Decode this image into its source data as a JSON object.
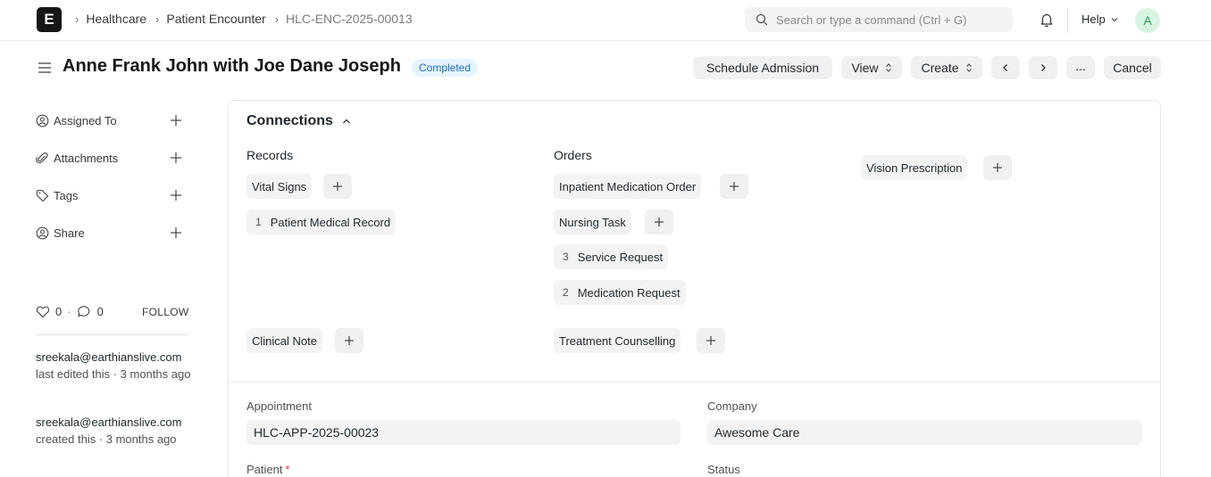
{
  "navbar": {
    "logo_letter": "E",
    "breadcrumbs": [
      "Healthcare",
      "Patient Encounter",
      "HLC-ENC-2025-00013"
    ],
    "search_placeholder": "Search or type a command (Ctrl + G)",
    "help_label": "Help",
    "avatar_letter": "A"
  },
  "header": {
    "title": "Anne Frank John with Joe Dane Joseph",
    "status": "Completed",
    "buttons": {
      "schedule_admission": "Schedule Admission",
      "view": "View",
      "create": "Create",
      "cancel": "Cancel",
      "more": "..."
    }
  },
  "sidebar": {
    "items": [
      {
        "label": "Assigned To",
        "icon": "assign-icon"
      },
      {
        "label": "Attachments",
        "icon": "paperclip-icon"
      },
      {
        "label": "Tags",
        "icon": "tag-icon"
      },
      {
        "label": "Share",
        "icon": "share-icon"
      }
    ],
    "likes": "0",
    "comments": "0",
    "follow_label": "FOLLOW",
    "activity": [
      {
        "user": "sreekala@earthianslive.com",
        "text": "last edited this · 3 months ago"
      },
      {
        "user": "sreekala@earthianslive.com",
        "text": "created this · 3 months ago"
      }
    ]
  },
  "connections": {
    "title": "Connections",
    "records_heading": "Records",
    "orders_heading": "Orders",
    "records": [
      {
        "label": "Vital Signs",
        "count": ""
      },
      {
        "label": "Patient Medical Record",
        "count": "1"
      },
      {
        "label": "Clinical Note",
        "count": ""
      }
    ],
    "orders": [
      {
        "label": "Inpatient Medication Order",
        "count": ""
      },
      {
        "label": "Nursing Task",
        "count": ""
      },
      {
        "label": "Service Request",
        "count": "3"
      },
      {
        "label": "Medication Request",
        "count": "2"
      },
      {
        "label": "Treatment Counselling",
        "count": ""
      }
    ],
    "other": [
      {
        "label": "Vision Prescription",
        "count": ""
      }
    ]
  },
  "form": {
    "appointment_label": "Appointment",
    "appointment_value": "HLC-APP-2025-00023",
    "company_label": "Company",
    "company_value": "Awesome Care",
    "patient_label": "Patient",
    "patient_required": "*",
    "status_label": "Status"
  },
  "colors": {
    "status_bg": "#e6f4ff",
    "status_text": "#1f6fc2",
    "required": "#e03636"
  }
}
